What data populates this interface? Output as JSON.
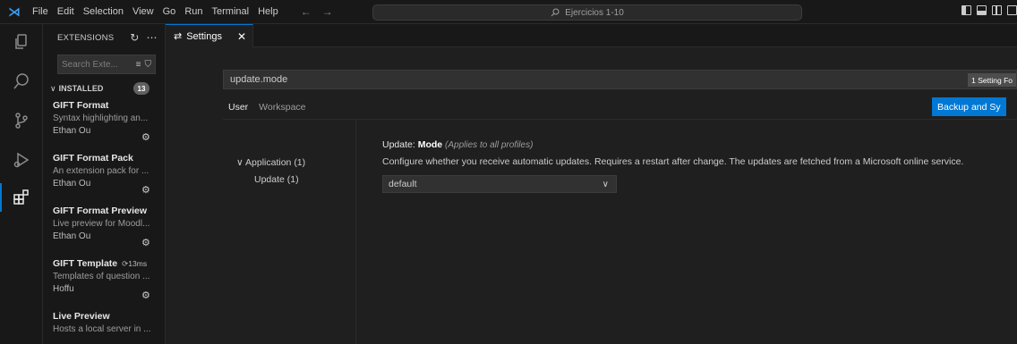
{
  "menu": [
    "File",
    "Edit",
    "Selection",
    "View",
    "Go",
    "Run",
    "Terminal",
    "Help"
  ],
  "command_center": {
    "text": "Ejercicios 1-10"
  },
  "sidebar": {
    "title": "EXTENSIONS",
    "search_placeholder": "Search Exte...",
    "installed_label": "INSTALLED",
    "installed_count": "13",
    "extensions": [
      {
        "name": "GIFT Format",
        "time": "",
        "description": "Syntax highlighting an...",
        "author": "Ethan Ou"
      },
      {
        "name": "GIFT Format Pack",
        "time": "",
        "description": "An extension pack for ...",
        "author": "Ethan Ou"
      },
      {
        "name": "GIFT Format Preview",
        "time": "",
        "description": "Live preview for Moodl...",
        "author": "Ethan Ou"
      },
      {
        "name": "GIFT Template",
        "time": "13ms",
        "description": "Templates of question ...",
        "author": "Hoffu"
      },
      {
        "name": "Live Preview",
        "time": "",
        "description": "Hosts a local server in ...",
        "author": ""
      }
    ]
  },
  "tab": {
    "label": "Settings"
  },
  "settings": {
    "search_value": "update.mode",
    "count_badge": "1 Setting Fo",
    "scope_user": "User",
    "scope_workspace": "Workspace",
    "backup_button": "Backup and Sy",
    "toc_application": "Application (1)",
    "toc_update": "Update (1)",
    "setting_category": "Update:",
    "setting_name": "Mode",
    "setting_scope": "(Applies to all profiles)",
    "setting_description": "Configure whether you receive automatic updates. Requires a restart after change. The updates are fetched from a Microsoft online service.",
    "setting_value": "default"
  },
  "colors": {
    "accent": "#0078d4",
    "background": "#1f1f1f",
    "sidebar": "#181818"
  },
  "icons": [
    "vscode-logo-icon",
    "explorer-icon",
    "search-icon",
    "source-control-icon",
    "run-debug-icon",
    "extensions-icon"
  ]
}
